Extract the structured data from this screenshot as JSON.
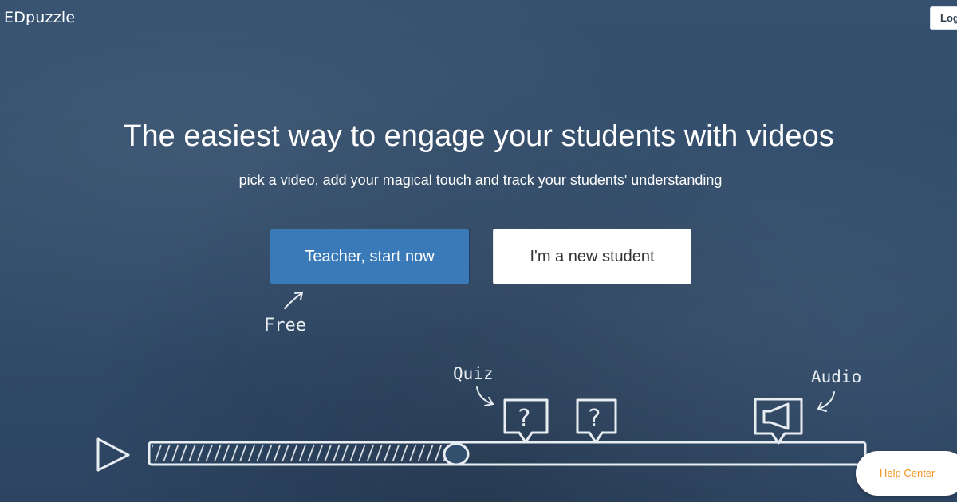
{
  "header": {
    "logo": "EDpuzzle",
    "login_label": "Log in"
  },
  "hero": {
    "headline": "The easiest way to engage your students with videos",
    "subheadline": "pick a video, add your magical touch and track your students' understanding",
    "teacher_button": "Teacher, start now",
    "student_button": "I'm a new student"
  },
  "illustration": {
    "free_label": "Free",
    "quiz_label": "Quiz",
    "audio_label": "Audio",
    "question_mark": "?",
    "icons": [
      "play-icon",
      "question-bubble-icon",
      "speaker-icon"
    ]
  },
  "help": {
    "label": "Help Center"
  },
  "colors": {
    "background": "#34506f",
    "teacher_button": "#3a7ab8",
    "help_text": "#f3931e"
  }
}
